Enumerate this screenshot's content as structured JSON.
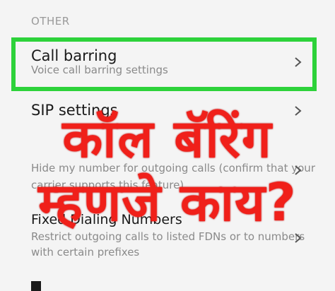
{
  "section": {
    "header": "OTHER"
  },
  "rows": [
    {
      "title": "Call barring",
      "subtitle": "Voice call barring settings"
    },
    {
      "title": "SIP settings",
      "subtitle": ""
    },
    {
      "title": "",
      "subtitle_line1": "Hide my number for outgoing calls (confirm that your",
      "subtitle_line2": "carrier supports this feature)"
    },
    {
      "title": "Fixed Dialing Numbers",
      "subtitle_line1": "Restrict outgoing calls to listed FDNs or to numbers",
      "subtitle_line2": "with certain prefixes"
    }
  ],
  "overlay": {
    "line1": "कॉल बॅरिंग",
    "line2": "म्हणजे काय?"
  },
  "colors": {
    "highlight": "#2dd23a",
    "overlay_text": "#f0201a",
    "background": "#f4f4f4"
  },
  "icons": {
    "row_chevron": "chevron-right-icon"
  }
}
